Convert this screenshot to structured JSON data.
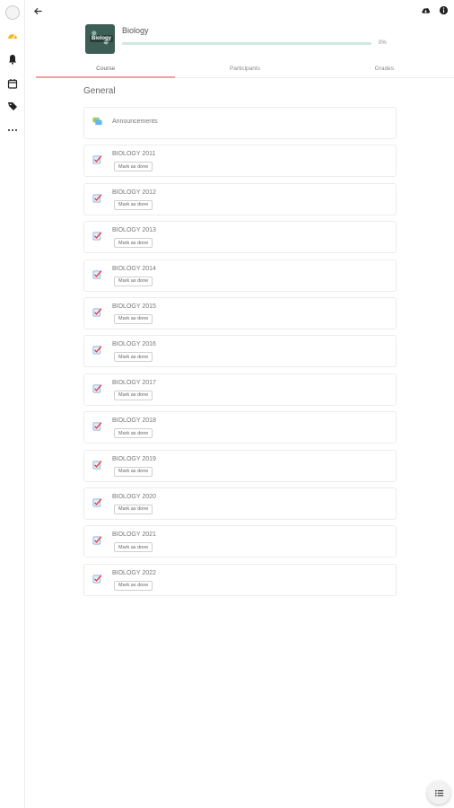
{
  "course": {
    "title": "Biology",
    "image_label": "Biology",
    "progress_text": "0%",
    "progress_fraction": 0
  },
  "tabs": [
    {
      "label": "Course"
    },
    {
      "label": "Participants"
    },
    {
      "label": "Grades"
    }
  ],
  "section": {
    "title": "General"
  },
  "announcements": {
    "label": "Announcements"
  },
  "activities": [
    {
      "name": "BIOLOGY 2011",
      "button": "Mark as done"
    },
    {
      "name": "BIOLOGY 2012",
      "button": "Mark as done"
    },
    {
      "name": "BIOLOGY 2013",
      "button": "Mark as done"
    },
    {
      "name": "BIOLOGY 2014",
      "button": "Mark as done"
    },
    {
      "name": "BIOLOGY 2015",
      "button": "Mark as done"
    },
    {
      "name": "BIOLOGY 2016",
      "button": "Mark as done"
    },
    {
      "name": "BIOLOGY 2017",
      "button": "Mark as done"
    },
    {
      "name": "BIOLOGY 2018",
      "button": "Mark as done"
    },
    {
      "name": "BIOLOGY 2019",
      "button": "Mark as done"
    },
    {
      "name": "BIOLOGY 2020",
      "button": "Mark as done"
    },
    {
      "name": "BIOLOGY 2021",
      "button": "Mark as done"
    },
    {
      "name": "BIOLOGY 2022",
      "button": "Mark as done"
    }
  ],
  "icons": {
    "rail": [
      "dashboard-icon",
      "bell-icon",
      "calendar-icon",
      "tag-icon",
      "more-icon"
    ],
    "topbar": [
      "back-arrow-icon",
      "cloud-download-icon",
      "info-icon"
    ],
    "fab": "list-icon"
  },
  "colors": {
    "accent_rail": "#f5b61a",
    "tab_indicator": "#f0a2a2",
    "progress": "#4caf87"
  }
}
